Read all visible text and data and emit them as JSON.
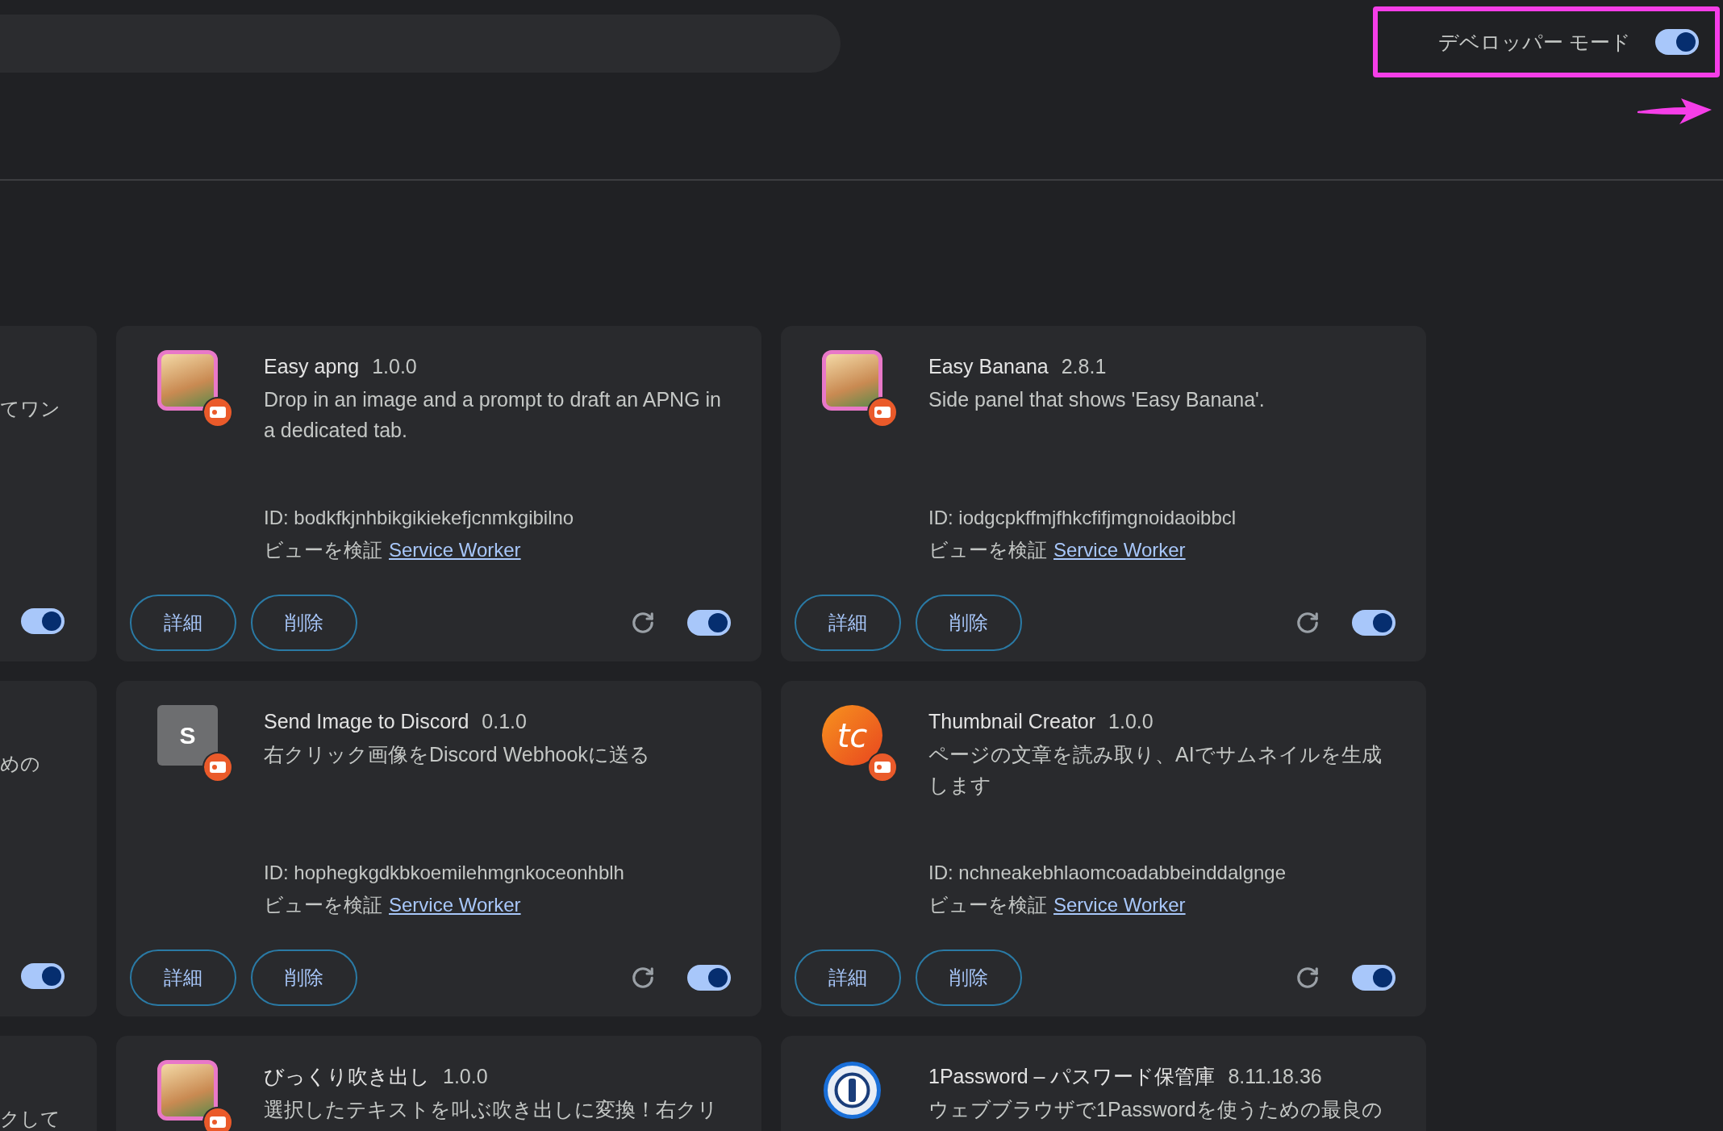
{
  "developer_mode": {
    "label": "デベロッパー モード",
    "on": true,
    "highlighted": true
  },
  "partial_cards": [
    {
      "description": "てワン",
      "enabled": true
    },
    {
      "description": "めの",
      "enabled": true
    },
    {
      "description": "クして"
    }
  ],
  "cards": [
    {
      "icon": {
        "kind": "avatar"
      },
      "unpacked": true,
      "name": "Easy apng",
      "version": "1.0.0",
      "description": "Drop in an image and a prompt to draft an APNG in a dedicated tab.",
      "id": "ID: bodkfkjnhbikgikiekefjcnmkgibilno",
      "inspect_label": "ビューを検証",
      "link": "Service Worker",
      "buttons": [
        "詳細",
        "削除"
      ],
      "enabled": true
    },
    {
      "icon": {
        "kind": "avatar"
      },
      "unpacked": true,
      "name": "Easy Banana",
      "version": "2.8.1",
      "description": "Side panel that shows 'Easy Banana'.",
      "id": "ID: iodgcpkffmjfhkcfifjmgnoidaoibbcl",
      "inspect_label": "ビューを検証",
      "link": "Service Worker",
      "buttons": [
        "詳細",
        "削除"
      ],
      "enabled": true
    },
    {
      "icon": {
        "kind": "letter",
        "text": "S"
      },
      "unpacked": true,
      "name": "Send Image to Discord",
      "version": "0.1.0",
      "description": "右クリック画像をDiscord Webhookに送る",
      "id": "ID: hophegkgdkbkoemilehmgnkoceonhblh",
      "inspect_label": "ビューを検証",
      "link": "Service Worker",
      "buttons": [
        "詳細",
        "削除"
      ],
      "enabled": true
    },
    {
      "icon": {
        "kind": "logo",
        "text": "tc"
      },
      "unpacked": true,
      "name": "Thumbnail Creator",
      "version": "1.0.0",
      "description": "ページの文章を読み取り、AIでサムネイルを生成します",
      "id": "ID: nchneakebhlaomcoadabbeinddalgnge",
      "inspect_label": "ビューを検証",
      "link": "Service Worker",
      "buttons": [
        "詳細",
        "削除"
      ],
      "enabled": true
    },
    {
      "icon": {
        "kind": "avatar"
      },
      "unpacked": true,
      "name": "びっくり吹き出し",
      "version": "1.0.0",
      "description": "選択したテキストを叫ぶ吹き出しに変換！右クリ"
    },
    {
      "icon": {
        "kind": "keyhole"
      },
      "unpacked": false,
      "name": "1Password – パスワード保管庫",
      "version": "8.11.18.36",
      "description": "ウェブブラウザで1Passwordを使うための最良の"
    }
  ]
}
